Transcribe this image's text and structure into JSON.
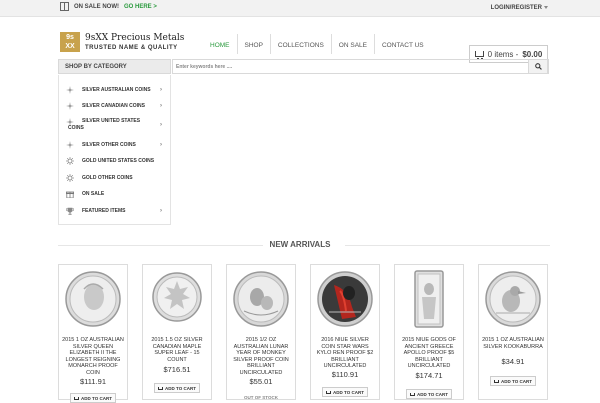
{
  "topbar": {
    "sale_text": "ON SALE NOW!",
    "sale_link": "GO HERE >",
    "login": "LOGIN/REGISTER"
  },
  "brand": {
    "logo_line1": "9s",
    "logo_line2": "XX",
    "name": "9sXX Precious Metals",
    "tagline": "TRUSTED NAME & QUALITY"
  },
  "nav": {
    "items": [
      "HOME",
      "SHOP",
      "COLLECTIONS",
      "ON SALE",
      "CONTACT US"
    ]
  },
  "cart": {
    "items": "0 items -",
    "total": "$0.00"
  },
  "category_bar": {
    "title": "SHOP BY CATEGORY"
  },
  "search": {
    "placeholder": "Enter keywords here ...."
  },
  "sidebar": {
    "items": [
      {
        "label": "SILVER AUSTRALIAN COINS",
        "icon": "cross-star-icon"
      },
      {
        "label": "SILVER CANADIAN COINS",
        "icon": "cross-star-icon"
      },
      {
        "label": "SILVER UNITED STATES COINS",
        "icon": "cross-star-icon"
      },
      {
        "label": "SILVER OTHER COINS",
        "icon": "cross-star-icon"
      },
      {
        "label": "GOLD UNITED STATES COINS",
        "icon": "sun-icon"
      },
      {
        "label": "GOLD OTHER COINS",
        "icon": "sun-icon"
      },
      {
        "label": "ON SALE",
        "icon": "gift-icon"
      },
      {
        "label": "FEATURED ITEMS",
        "icon": "trophy-icon"
      }
    ]
  },
  "section": {
    "title": "NEW ARRIVALS"
  },
  "products": [
    {
      "name": "2015 1 OZ AUSTRALIAN SILVER QUEEN ELIZABETH II THE LONGEST REIGNING MONARCH PROOF COIN",
      "price": "$111.91",
      "button": "ADD TO CART",
      "status": ""
    },
    {
      "name": "2015 1.5 OZ SILVER CANADIAN MAPLE SUPER LEAF - 15 COUNT",
      "price": "$716.51",
      "button": "ADD TO CART",
      "status": ""
    },
    {
      "name": "2015 1/2 OZ AUSTRALIAN LUNAR YEAR OF MONKEY SILVER PROOF COIN BRILLIANT UNCIRCULATED",
      "price": "$55.01",
      "button": "",
      "status": "OUT OF STOCK"
    },
    {
      "name": "2016 NIUE SILVER COIN STAR WARS KYLO REN PROOF $2 BRILLIANT UNCIRCULATED",
      "price": "$110.91",
      "button": "ADD TO CART",
      "status": ""
    },
    {
      "name": "2015 NIUE GODS OF ANCIENT GREECE APOLLO PROOF $5 BRILLIANT UNCIRCULATED",
      "price": "$174.71",
      "button": "ADD TO CART",
      "status": ""
    },
    {
      "name": "2015 1 OZ AUSTRALIAN SILVER KOOKABURRA",
      "price": "$34.91",
      "button": "ADD TO CART",
      "status": ""
    }
  ],
  "colors": {
    "accent_green": "#2a9a3d",
    "logo_gold": "#c8a24c"
  }
}
